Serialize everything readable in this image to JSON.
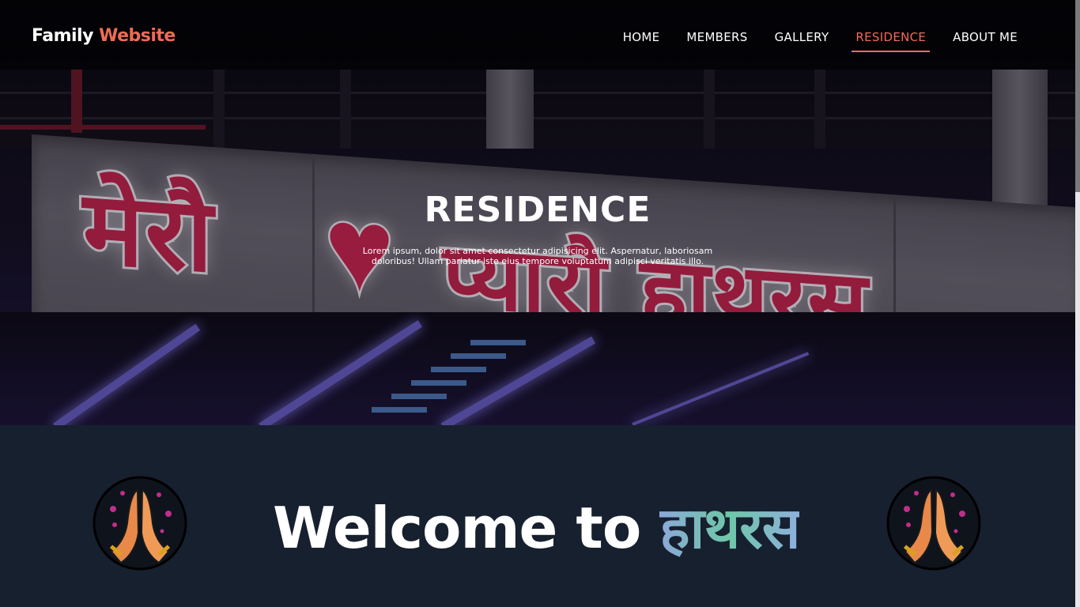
{
  "brand": {
    "part1": "Family",
    "part2": "Website"
  },
  "nav": {
    "items": [
      {
        "label": "HOME",
        "active": false
      },
      {
        "label": "MEMBERS",
        "active": false
      },
      {
        "label": "GALLERY",
        "active": false
      },
      {
        "label": "RESIDENCE",
        "active": true
      },
      {
        "label": "ABOUT ME",
        "active": false
      }
    ]
  },
  "hero": {
    "sign_text_left": "मेरौ",
    "sign_text_right": "प्यारौ हाथरस",
    "title": "RESIDENCE",
    "subtitle": "Lorem ipsum, dolor sit amet consectetur adipisicing elit. Aspernatur, laboriosam doloribus! Ullam pariatur iste eius tempore voluptatum adipisci veritatis illo."
  },
  "welcome": {
    "prefix": "Welcome to ",
    "city": "हाथरस",
    "icon_left": "namaste-hands-icon",
    "icon_right": "namaste-hands-icon"
  },
  "colors": {
    "accent": "#f06b55",
    "nav_bg": "#000000",
    "section_bg": "#17202f"
  }
}
